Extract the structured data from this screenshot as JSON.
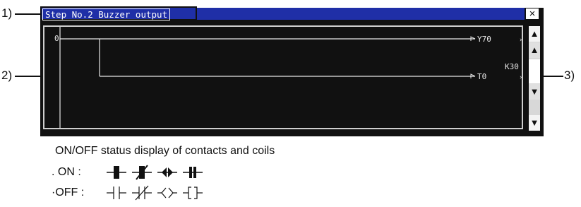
{
  "callouts": [
    {
      "id": "1",
      "label": "1)"
    },
    {
      "id": "2",
      "label": "2)"
    },
    {
      "id": "3",
      "label": "3)"
    }
  ],
  "window": {
    "title": "Step No.2 Buzzer output",
    "close_glyph": "×"
  },
  "ladder": {
    "step_number": "0",
    "coil_1": "Y70",
    "coil_2": "T0",
    "timer_setting": "K30"
  },
  "scrollbar": {
    "top_arrow": "▲",
    "up_arrow": "▲",
    "down_arrow": "▼",
    "bottom_arrow": "▼"
  },
  "legend": {
    "title": "ON/OFF status display of contacts and coils",
    "on_label": ". ON  :",
    "off_label": "·OFF  :"
  },
  "colors": {
    "titlebar": "#1f2fa7",
    "screen_background": "#111111",
    "ladder_lines": "#e8e8e8"
  }
}
